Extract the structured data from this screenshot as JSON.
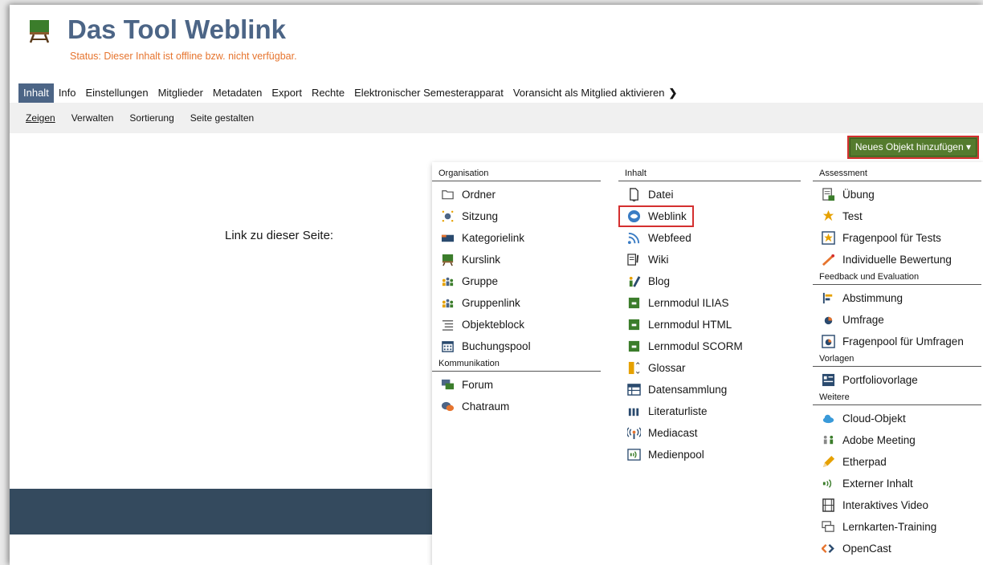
{
  "header": {
    "title": "Das Tool Weblink",
    "status": "Status: Dieser Inhalt ist offline bzw. nicht verfügbar."
  },
  "tabs": [
    {
      "label": "Inhalt",
      "active": true
    },
    {
      "label": "Info"
    },
    {
      "label": "Einstellungen"
    },
    {
      "label": "Mitglieder"
    },
    {
      "label": "Metadaten"
    },
    {
      "label": "Export"
    },
    {
      "label": "Rechte"
    },
    {
      "label": "Elektronischer Semesterapparat"
    },
    {
      "label": "Voransicht als Mitglied aktivieren"
    }
  ],
  "subtabs": [
    {
      "label": "Zeigen",
      "active": true
    },
    {
      "label": "Verwalten"
    },
    {
      "label": "Sortierung"
    },
    {
      "label": "Seite gestalten"
    }
  ],
  "add_button": "Neues Objekt hinzufügen ▾",
  "link_label": "Link zu dieser Seite:",
  "dropdown": {
    "col1": [
      {
        "heading": "Organisation",
        "items": [
          {
            "label": "Ordner",
            "icon": "folder-icon"
          },
          {
            "label": "Sitzung",
            "icon": "session-icon"
          },
          {
            "label": "Kategorielink",
            "icon": "category-link-icon"
          },
          {
            "label": "Kurslink",
            "icon": "course-link-icon"
          },
          {
            "label": "Gruppe",
            "icon": "group-icon"
          },
          {
            "label": "Gruppenlink",
            "icon": "group-link-icon"
          },
          {
            "label": "Objekteblock",
            "icon": "object-block-icon"
          },
          {
            "label": "Buchungspool",
            "icon": "booking-pool-icon"
          }
        ]
      },
      {
        "heading": "Kommunikation",
        "items": [
          {
            "label": "Forum",
            "icon": "forum-icon"
          },
          {
            "label": "Chatraum",
            "icon": "chatroom-icon"
          }
        ]
      }
    ],
    "col2": [
      {
        "heading": "Inhalt",
        "items": [
          {
            "label": "Datei",
            "icon": "file-icon"
          },
          {
            "label": "Weblink",
            "icon": "weblink-icon",
            "highlight": true
          },
          {
            "label": "Webfeed",
            "icon": "webfeed-icon"
          },
          {
            "label": "Wiki",
            "icon": "wiki-icon"
          },
          {
            "label": "Blog",
            "icon": "blog-icon"
          },
          {
            "label": "Lernmodul ILIAS",
            "icon": "learning-module-icon"
          },
          {
            "label": "Lernmodul HTML",
            "icon": "learning-module-icon"
          },
          {
            "label": "Lernmodul SCORM",
            "icon": "learning-module-icon"
          },
          {
            "label": "Glossar",
            "icon": "glossary-icon"
          },
          {
            "label": "Datensammlung",
            "icon": "data-collection-icon"
          },
          {
            "label": "Literaturliste",
            "icon": "bibliography-icon"
          },
          {
            "label": "Mediacast",
            "icon": "mediacast-icon"
          },
          {
            "label": "Medienpool",
            "icon": "media-pool-icon"
          }
        ]
      }
    ],
    "col3": [
      {
        "heading": "Assessment",
        "items": [
          {
            "label": "Übung",
            "icon": "exercise-icon"
          },
          {
            "label": "Test",
            "icon": "test-icon"
          },
          {
            "label": "Fragenpool für Tests",
            "icon": "question-pool-icon"
          },
          {
            "label": "Individuelle Bewertung",
            "icon": "individual-assessment-icon"
          }
        ]
      },
      {
        "heading": "Feedback und Evaluation",
        "items": [
          {
            "label": "Abstimmung",
            "icon": "poll-icon"
          },
          {
            "label": "Umfrage",
            "icon": "survey-icon"
          },
          {
            "label": "Fragenpool für Umfragen",
            "icon": "survey-pool-icon"
          }
        ]
      },
      {
        "heading": "Vorlagen",
        "items": [
          {
            "label": "Portfoliovorlage",
            "icon": "portfolio-template-icon"
          }
        ]
      },
      {
        "heading": "Weitere",
        "items": [
          {
            "label": "Cloud-Objekt",
            "icon": "cloud-icon"
          },
          {
            "label": "Adobe Meeting",
            "icon": "meeting-icon"
          },
          {
            "label": "Etherpad",
            "icon": "pencil-icon"
          },
          {
            "label": "Externer Inhalt",
            "icon": "external-content-icon"
          },
          {
            "label": "Interaktives Video",
            "icon": "video-icon"
          },
          {
            "label": "Lernkarten-Training",
            "icon": "flashcards-icon"
          },
          {
            "label": "OpenCast",
            "icon": "opencast-icon"
          }
        ]
      }
    ]
  }
}
